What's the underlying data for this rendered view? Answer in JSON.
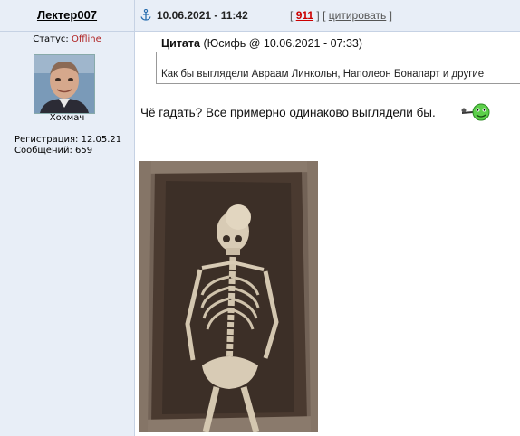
{
  "post": {
    "author": "Лектер007",
    "date": "10.06.2021 - 11:42",
    "post_number": "911",
    "bracket_open": "[",
    "bracket_close": "]",
    "cite_label": "цитировать"
  },
  "user": {
    "status_label": "Статус:",
    "status_value": "Offline",
    "title": "Хохмач",
    "registration": "Регистрация: 12.05.21",
    "messages": "Сообщений: 659"
  },
  "quote": {
    "label": "Цитата",
    "source": "(Юсифь @ 10.06.2021 - 07:33)",
    "text": "Как бы выглядели Авраам Линкольн, Наполеон Бонапарт и другие"
  },
  "body": {
    "text": "Чё гадать? Все примерно одинаково выглядели бы."
  },
  "icons": {
    "anchor": "anchor-icon",
    "smiley": "smiley-with-pipe-icon"
  },
  "colors": {
    "header_bg": "#e8eef7",
    "offline": "#b02020",
    "post_number": "#cc0000"
  }
}
